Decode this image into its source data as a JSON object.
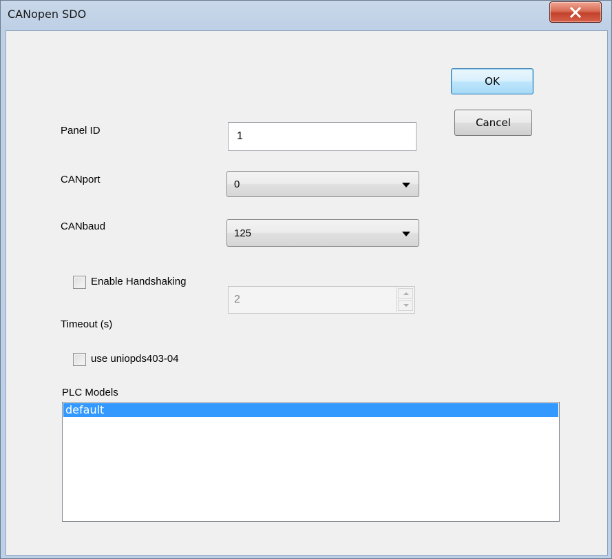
{
  "window": {
    "title": "CANopen SDO"
  },
  "buttons": {
    "ok": "OK",
    "cancel": "Cancel"
  },
  "fields": {
    "panel_id": {
      "label": "Panel ID",
      "value": "1"
    },
    "canport": {
      "label": "CANport",
      "value": "0"
    },
    "canbaud": {
      "label": "CANbaud",
      "value": "125"
    },
    "timeout": {
      "label": "Timeout (s)",
      "value": "2"
    }
  },
  "checkboxes": {
    "handshaking": {
      "label": "Enable Handshaking",
      "checked": false
    },
    "uniopds": {
      "label": "use uniopds403-04",
      "checked": false
    }
  },
  "plc_models": {
    "label": "PLC Models",
    "items": [
      {
        "label": "default",
        "selected": true
      }
    ]
  },
  "colors": {
    "selection": "#3399ff",
    "close_button": "#c2432d",
    "dialog_background": "#f0f0f0",
    "frame": "#bcd0e7"
  },
  "icons": {
    "close": "close-icon"
  }
}
